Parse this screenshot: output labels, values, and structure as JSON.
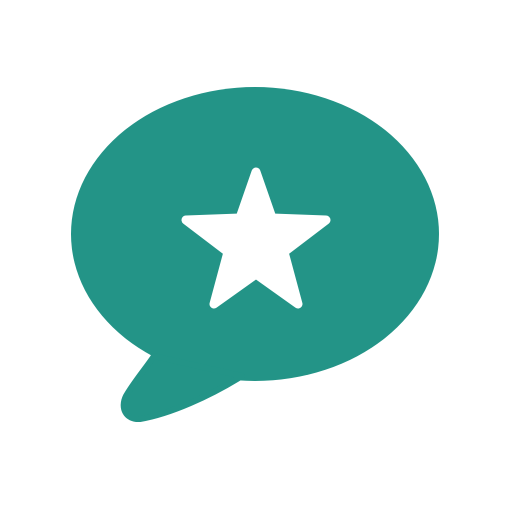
{
  "icon": {
    "name": "speech-bubble-star-icon",
    "colors": {
      "background": "#ffffff",
      "bubble": "#239487",
      "star": "#ffffff"
    }
  }
}
